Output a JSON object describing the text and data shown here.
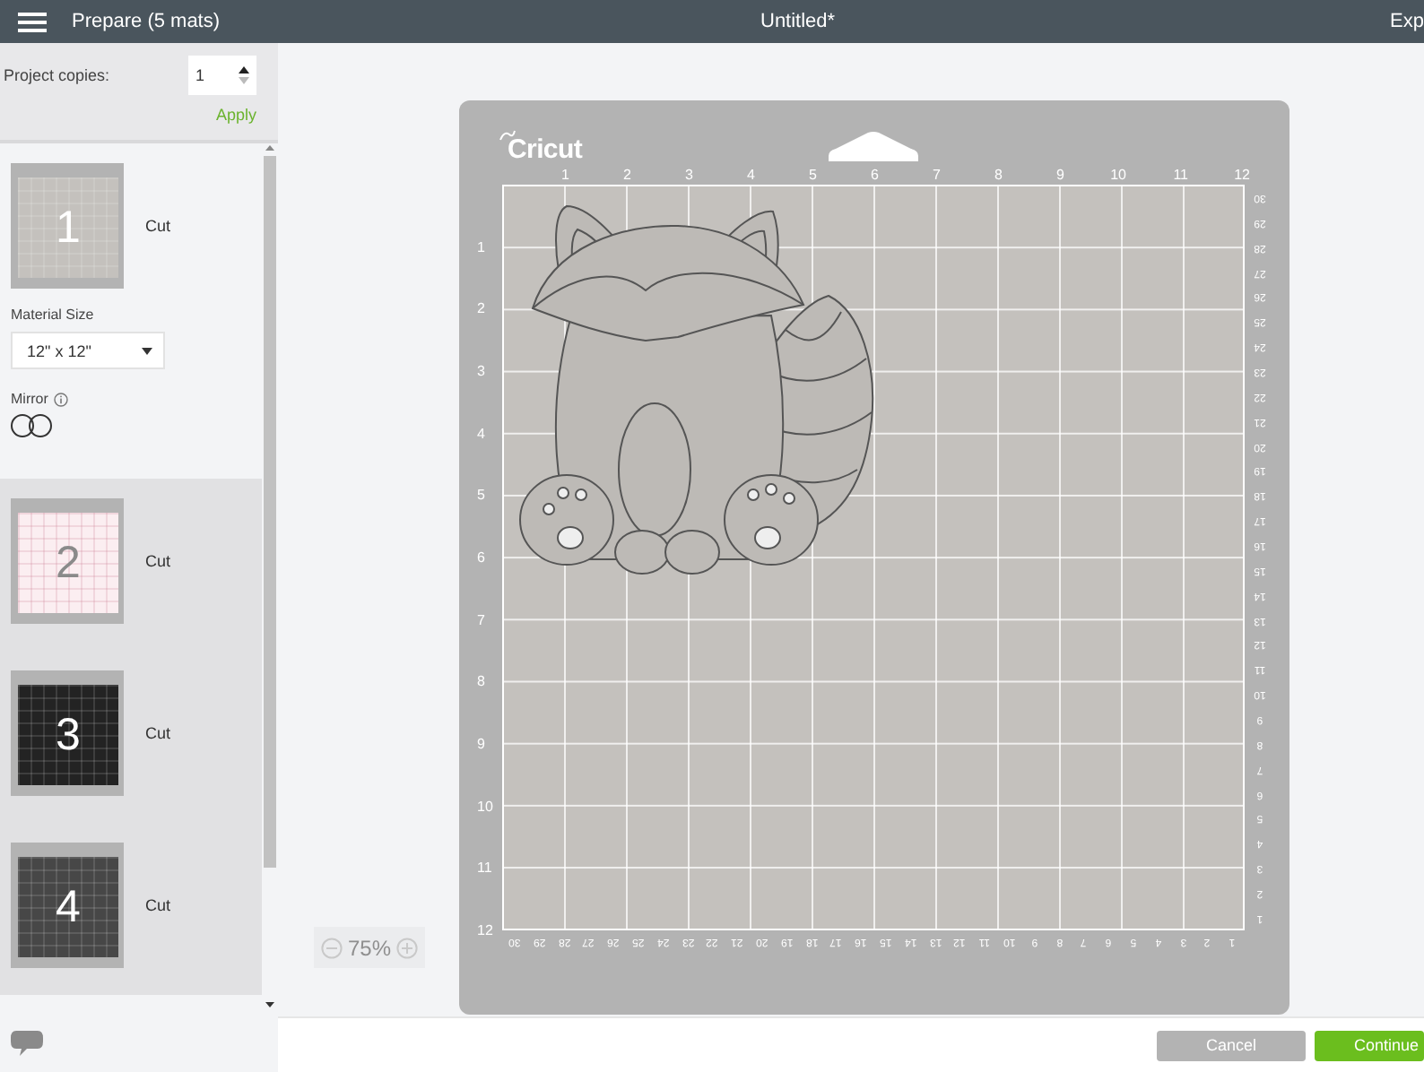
{
  "app_bar": {
    "title": "Prepare (5 mats)",
    "document_title": "Untitled*",
    "action": "Exp"
  },
  "sidebar": {
    "project_copies": {
      "label": "Project copies:",
      "value": "1"
    },
    "apply": "Apply",
    "mats": [
      {
        "number": "1",
        "label": "Cut",
        "color": "#c4c1bd",
        "selected": true,
        "material_size": {
          "label": "Material Size",
          "value": "12\" x 12\""
        },
        "mirror": {
          "label": "Mirror",
          "on": false
        }
      },
      {
        "number": "2",
        "label": "Cut",
        "color": "#fbeef1",
        "selected": false
      },
      {
        "number": "3",
        "label": "Cut",
        "color": "#232323",
        "selected": false
      },
      {
        "number": "4",
        "label": "Cut",
        "color": "#474747",
        "selected": false
      }
    ]
  },
  "mat_preview": {
    "logo": "Cricut",
    "top_ruler": [
      "1",
      "2",
      "3",
      "4",
      "5",
      "6",
      "7",
      "8",
      "9",
      "10",
      "11",
      "12"
    ],
    "left_ruler": [
      "1",
      "2",
      "3",
      "4",
      "5",
      "6",
      "7",
      "8",
      "9",
      "10",
      "11",
      "12"
    ],
    "right_ruler": [
      "30",
      "29",
      "28",
      "27",
      "26",
      "25",
      "24",
      "23",
      "22",
      "21",
      "20",
      "19",
      "18",
      "17",
      "16",
      "15",
      "14",
      "13",
      "12",
      "11",
      "10",
      "9",
      "8",
      "7",
      "6",
      "5",
      "4",
      "3",
      "2",
      "1"
    ],
    "bottom_ruler": [
      "30",
      "29",
      "28",
      "27",
      "26",
      "25",
      "24",
      "23",
      "22",
      "21",
      "20",
      "19",
      "18",
      "17",
      "16",
      "15",
      "14",
      "13",
      "12",
      "11",
      "10",
      "9",
      "8",
      "7",
      "6",
      "5",
      "4",
      "3",
      "2",
      "1"
    ]
  },
  "zoom": {
    "value": "75%"
  },
  "footer": {
    "buttons": [
      {
        "label": "Cancel",
        "kind": "secondary"
      },
      {
        "label": "Continue",
        "kind": "primary"
      }
    ]
  }
}
